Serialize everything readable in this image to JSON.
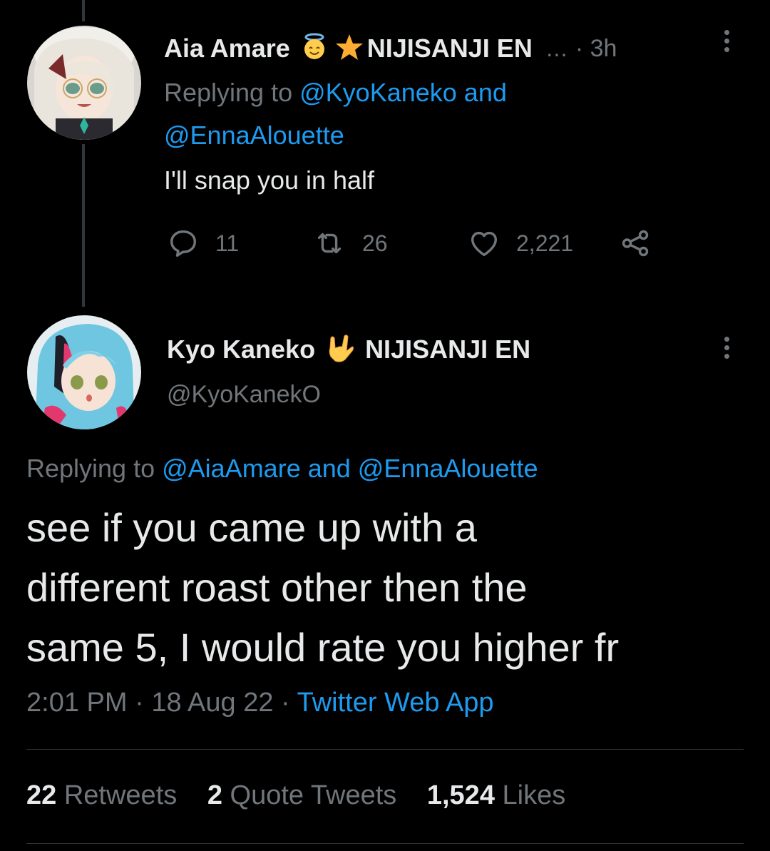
{
  "reply_tweet": {
    "author_name": "Aia Amare",
    "author_suffix": "NIJISANJI EN",
    "ellipsis": "…",
    "time": "· 3h",
    "replying_prefix": "Replying to ",
    "replying_user1": "@KyoKaneko",
    "replying_and": " and",
    "replying_user2": "@EnnaAlouette",
    "text": "I'll snap you in half",
    "replies": "11",
    "retweets": "26",
    "likes": "2,221"
  },
  "main_tweet": {
    "author_name": "Kyo Kaneko",
    "author_suffix": "NIJISANJI EN",
    "handle": "@KyoKanekO",
    "replying_prefix": "Replying to ",
    "replying_user1": "@AiaAmare",
    "replying_and": " and ",
    "replying_user2": "@EnnaAlouette",
    "text_line1": "see if you came up with a",
    "text_line2": "different roast other then the",
    "text_line3": "same 5, I would rate you higher fr",
    "time": "2:01 PM",
    "date": "18 Aug 22",
    "source": "Twitter Web App",
    "stats": {
      "retweets_count": "22",
      "retweets_label": "Retweets",
      "quotes_count": "2",
      "quotes_label": "Quote Tweets",
      "likes_count": "1,524",
      "likes_label": "Likes"
    }
  },
  "colors": {
    "background": "#000000",
    "text": "#e7e9ea",
    "muted": "#71767b",
    "link": "#1d9bf0",
    "divider": "#2f3336"
  }
}
